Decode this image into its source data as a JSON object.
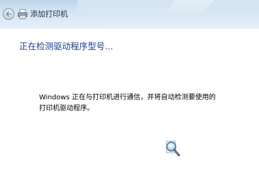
{
  "window": {
    "title": "添加打印机"
  },
  "main": {
    "heading": "正在检测驱动程序型号...",
    "message_line1": "Windows 正在与打印机进行通信，并将自动检测要使用的",
    "message_line2": "打印机驱动程序。"
  },
  "icons": {
    "back": "back-arrow-icon",
    "printer": "printer-icon",
    "search": "search-magnifier-icon"
  },
  "colors": {
    "heading": "#1f3d8c",
    "titlebar": "#d4e3f3"
  }
}
